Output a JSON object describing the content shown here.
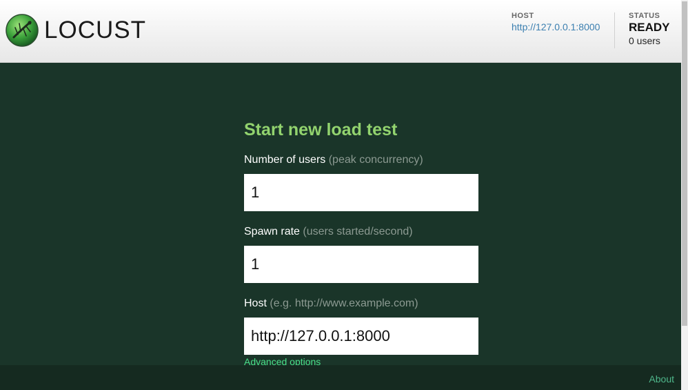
{
  "header": {
    "brand": "LOCUST",
    "host_label": "HOST",
    "host_url": "http://127.0.0.1:8000",
    "status_label": "STATUS",
    "status_value": "READY",
    "status_users": "0 users"
  },
  "form": {
    "title": "Start new load test",
    "users_label": "Number of users",
    "users_hint": "(peak concurrency)",
    "users_value": "1",
    "spawn_label": "Spawn rate",
    "spawn_hint": "(users started/second)",
    "spawn_value": "1",
    "host_label": "Host",
    "host_hint": "(e.g. http://www.example.com)",
    "host_value": "http://127.0.0.1:8000",
    "advanced_link": "Advanced options"
  },
  "footer": {
    "about_link": "About"
  },
  "colors": {
    "background": "#1a3529",
    "accent_green": "#92d36e",
    "link_green": "#4ae08a",
    "host_link_blue": "#3b7fb0"
  },
  "icons": {
    "logo": "locust-logo-icon"
  }
}
